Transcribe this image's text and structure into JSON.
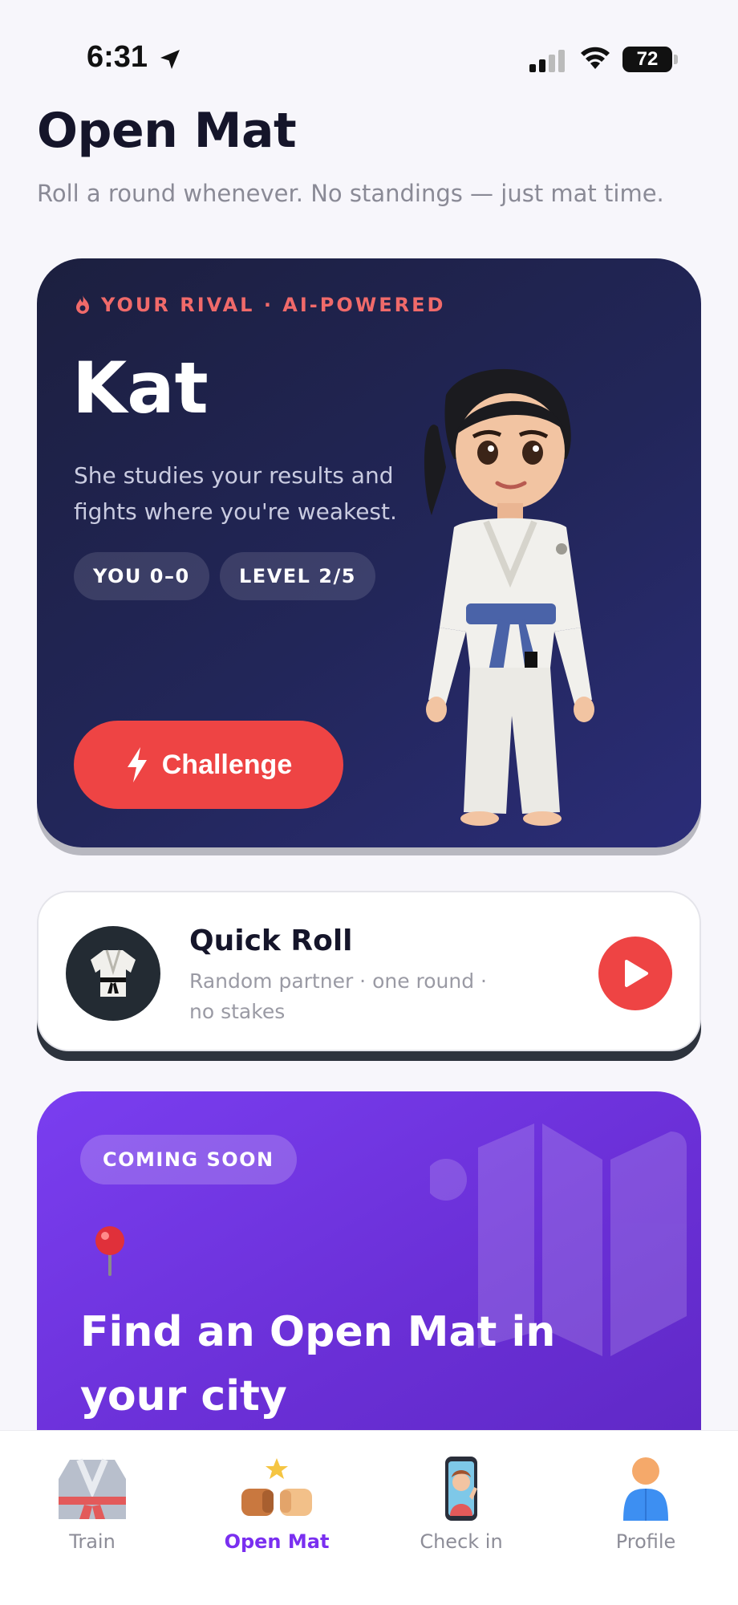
{
  "status_bar": {
    "time": "6:31",
    "battery": "72"
  },
  "header": {
    "title": "Open Mat",
    "subtitle": "Roll a round whenever. No standings — just mat time."
  },
  "rival_card": {
    "eyebrow": "YOUR RIVAL · AI-POWERED",
    "name": "Kat",
    "description": "She studies your results and fights where you're weakest.",
    "record_chip": "YOU 0–0",
    "level_chip": "LEVEL 2/5",
    "challenge_label": "Challenge",
    "accent_color": "#ee4444"
  },
  "quick_roll": {
    "title": "Quick Roll",
    "subtitle": "Random partner · one round · no stakes"
  },
  "coming_soon": {
    "badge": "COMING SOON",
    "title": "Find an Open Mat in your city",
    "brand_color": "#7a3ef0"
  },
  "tab_bar": {
    "tabs": [
      {
        "label": "Train",
        "icon": "gi-icon"
      },
      {
        "label": "Open Mat",
        "icon": "fist-bump-icon",
        "active": true
      },
      {
        "label": "Check in",
        "icon": "phone-selfie-icon"
      },
      {
        "label": "Profile",
        "icon": "person-icon"
      }
    ],
    "active_color": "#7a2ff0"
  }
}
